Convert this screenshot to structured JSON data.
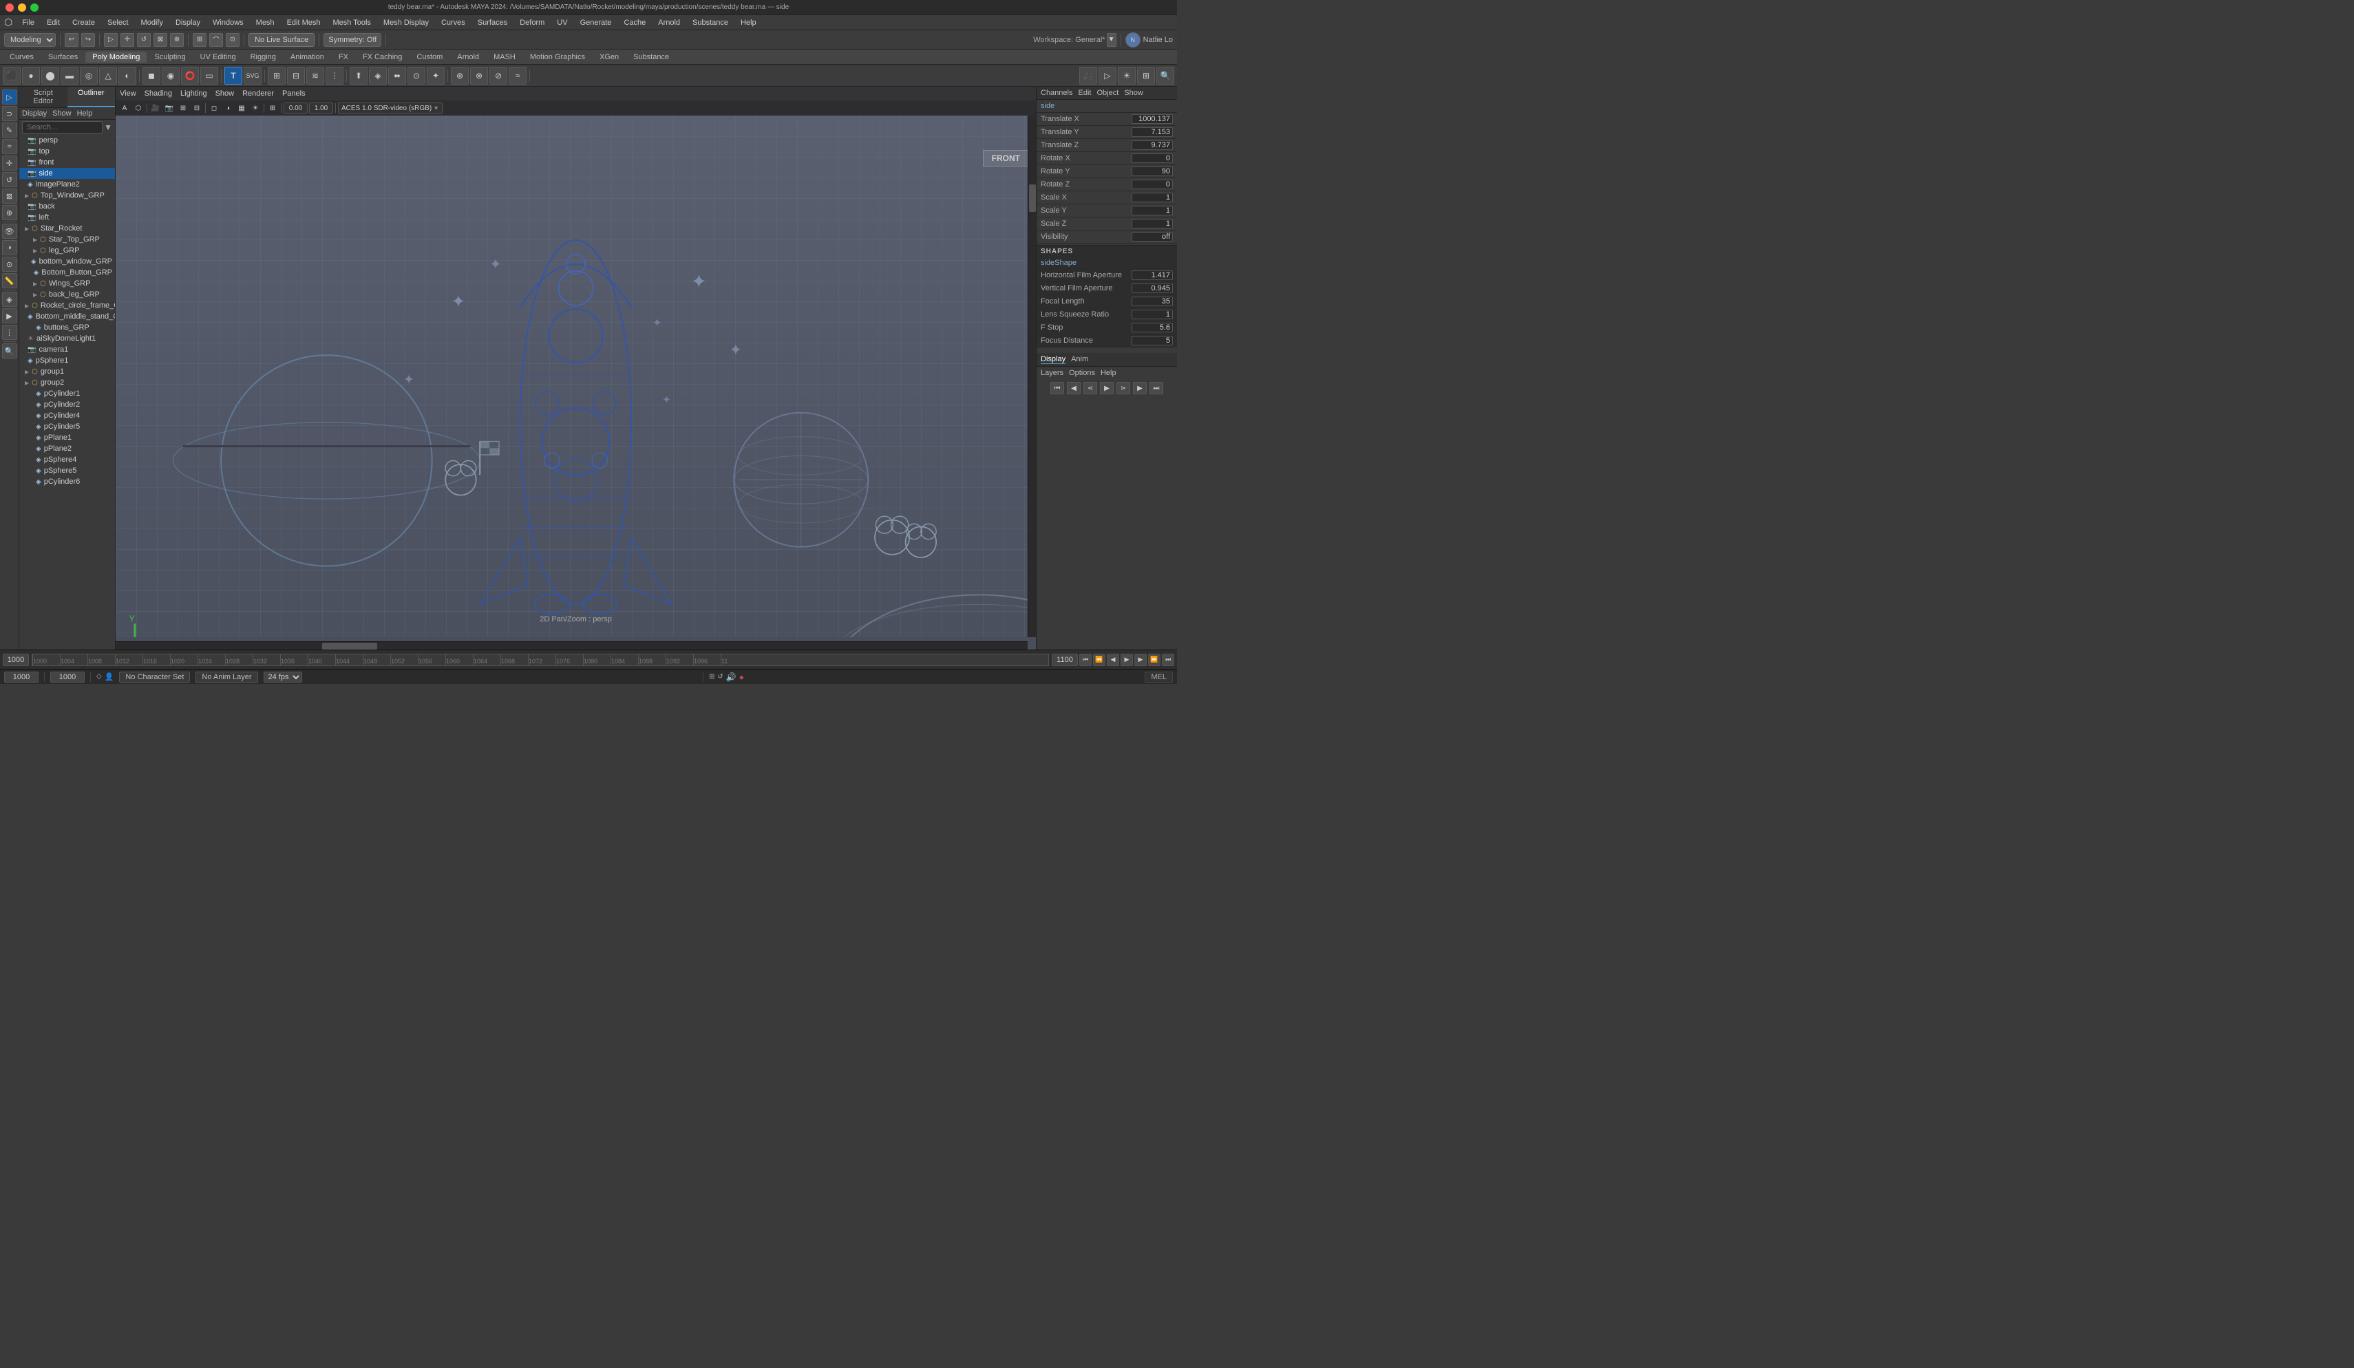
{
  "titleBar": {
    "title": "teddy bear.ma* - Autodesk MAYA 2024: /Volumes/SAMDATA/Natlo/Rocket/modeling/maya/production/scenes/teddy bear.ma --- side"
  },
  "menuBar": {
    "items": [
      "File",
      "Edit",
      "Create",
      "Select",
      "Modify",
      "Display",
      "Windows",
      "Mesh",
      "Edit Mesh",
      "Mesh Tools",
      "Mesh Display",
      "Curves",
      "Surfaces",
      "Deform",
      "UV",
      "Generate",
      "Cache",
      "Arnold",
      "Substance",
      "Help"
    ]
  },
  "toolbar1": {
    "workspace_label": "Modeling",
    "no_live_surface": "No Live Surface",
    "symmetry_label": "Symmetry: Off",
    "user_label": "Natlie Lo",
    "workspace_right": "Workspace: General*"
  },
  "tabRow": {
    "tabs": [
      "Curves",
      "Surfaces",
      "Poly Modeling",
      "Sculpting",
      "UV Editing",
      "Rigging",
      "Animation",
      "FX",
      "FX Caching",
      "Custom",
      "Arnold",
      "MASH",
      "Motion Graphics",
      "XGen",
      "Substance"
    ]
  },
  "viewport": {
    "menu_items": [
      "View",
      "Shading",
      "Lighting",
      "Show",
      "Renderer",
      "Panels"
    ],
    "label": "FRONT",
    "bottom_label": "2D Pan/Zoom : persp",
    "axis_label": "XYZ"
  },
  "outliner": {
    "tabs": [
      "Script Editor",
      "Outliner"
    ],
    "active_tab": "Outliner",
    "menu_items": [
      "Display",
      "Show",
      "Help"
    ],
    "search_placeholder": "Search...",
    "items": [
      {
        "name": "persp",
        "type": "cam",
        "indent": 0
      },
      {
        "name": "top",
        "type": "cam",
        "indent": 0
      },
      {
        "name": "front",
        "type": "cam",
        "indent": 0
      },
      {
        "name": "side",
        "type": "cam",
        "indent": 0,
        "selected": true
      },
      {
        "name": "imagePlane2",
        "type": "mesh",
        "indent": 0
      },
      {
        "name": "Top_Window_GRP",
        "type": "group",
        "indent": 0
      },
      {
        "name": "back",
        "type": "cam",
        "indent": 0
      },
      {
        "name": "left",
        "type": "cam",
        "indent": 0
      },
      {
        "name": "Star_Rocket",
        "type": "group",
        "indent": 0
      },
      {
        "name": "Star_Top_GRP",
        "type": "group",
        "indent": 1
      },
      {
        "name": "leg_GRP",
        "type": "group",
        "indent": 1
      },
      {
        "name": "bottom_window_GRP",
        "type": "mesh",
        "indent": 2
      },
      {
        "name": "Bottom_Button_GRP",
        "type": "mesh",
        "indent": 2
      },
      {
        "name": "Wings_GRP",
        "type": "group",
        "indent": 1
      },
      {
        "name": "back_leg_GRP",
        "type": "group",
        "indent": 1
      },
      {
        "name": "Rocket_circle_frame_GRP",
        "type": "group",
        "indent": 1
      },
      {
        "name": "Bottom_middle_stand_GRP",
        "type": "mesh",
        "indent": 2
      },
      {
        "name": "buttons_GRP",
        "type": "mesh",
        "indent": 1
      },
      {
        "name": "aiSkyDomeLight1",
        "type": "light",
        "indent": 0
      },
      {
        "name": "camera1",
        "type": "cam",
        "indent": 0
      },
      {
        "name": "pSphere1",
        "type": "mesh",
        "indent": 0
      },
      {
        "name": "group1",
        "type": "group",
        "indent": 0
      },
      {
        "name": "group2",
        "type": "group",
        "indent": 0
      },
      {
        "name": "pCylinder1",
        "type": "mesh",
        "indent": 1
      },
      {
        "name": "pCylinder2",
        "type": "mesh",
        "indent": 1
      },
      {
        "name": "pCylinder4",
        "type": "mesh",
        "indent": 1
      },
      {
        "name": "pCylinder5",
        "type": "mesh",
        "indent": 1
      },
      {
        "name": "pPlane1",
        "type": "mesh",
        "indent": 1
      },
      {
        "name": "pPlane2",
        "type": "mesh",
        "indent": 1
      },
      {
        "name": "pSphere4",
        "type": "mesh",
        "indent": 1
      },
      {
        "name": "pSphere5",
        "type": "mesh",
        "indent": 1
      },
      {
        "name": "pCylinder6",
        "type": "mesh",
        "indent": 1
      }
    ]
  },
  "channelBox": {
    "header_menus": [
      "Channels",
      "Edit",
      "Object",
      "Show"
    ],
    "selected_node": "side",
    "attributes": [
      {
        "label": "Translate X",
        "value": "1000.137"
      },
      {
        "label": "Translate Y",
        "value": "7.153"
      },
      {
        "label": "Translate Z",
        "value": "9.737"
      },
      {
        "label": "Rotate X",
        "value": "0"
      },
      {
        "label": "Rotate Y",
        "value": "90"
      },
      {
        "label": "Rotate Z",
        "value": "0"
      },
      {
        "label": "Scale X",
        "value": "1"
      },
      {
        "label": "Scale Y",
        "value": "1"
      },
      {
        "label": "Scale Z",
        "value": "1"
      },
      {
        "label": "Visibility",
        "value": "off"
      }
    ],
    "shapes_title": "SHAPES",
    "shape_node": "sideShape",
    "shape_attrs": [
      {
        "label": "Horizontal Film Aperture",
        "value": "1.417"
      },
      {
        "label": "Vertical Film Aperture",
        "value": "0.945"
      },
      {
        "label": "Focal Length",
        "value": "35"
      },
      {
        "label": "Lens Squeeze Ratio",
        "value": "1"
      },
      {
        "label": "F Stop",
        "value": "5.6"
      },
      {
        "label": "Focus Distance",
        "value": "5"
      }
    ]
  },
  "bottomTabs": {
    "tabs": [
      "Display",
      "Anim"
    ],
    "sublabs": [
      "Layers",
      "Options",
      "Help"
    ]
  },
  "timeline": {
    "start": "1000",
    "end": "1000",
    "current": "1000",
    "ticks": [
      "1000",
      "1004",
      "1008",
      "1012",
      "1016",
      "1020",
      "1024",
      "1028",
      "1032",
      "1036",
      "1040",
      "1044",
      "1048",
      "1052",
      "1056",
      "1060",
      "1064",
      "1068",
      "1072",
      "1076",
      "1080",
      "1084",
      "1088",
      "1092",
      "1096",
      "11"
    ],
    "playback_end": "1100",
    "playback_end2": "1100"
  },
  "statusBar": {
    "frame_start": "1000",
    "frame_end": "1000",
    "no_character_set": "No Character Set",
    "no_anim_layer": "No Anim Layer",
    "fps": "24 fps",
    "mel_label": "MEL"
  },
  "icons": {
    "move": "↖",
    "rotate": "↺",
    "scale": "⊞",
    "select": "▷",
    "camera": "📷",
    "light": "💡",
    "play": "▶",
    "pause": "⏸",
    "stop": "■",
    "prev": "◀",
    "next": "▶",
    "first": "⏮",
    "last": "⏭",
    "camera_icon": "🎥",
    "mesh_icon": "◈",
    "group_icon": "▷",
    "expand": "▷",
    "collapse": "▼"
  }
}
